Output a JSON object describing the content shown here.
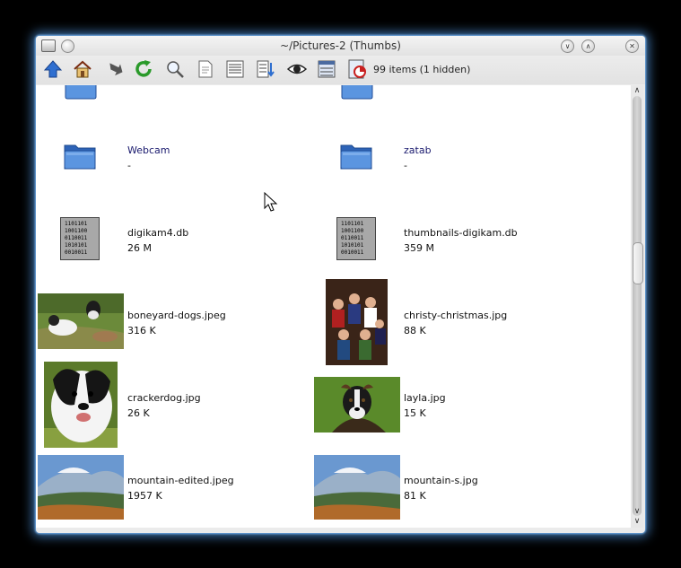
{
  "window": {
    "title": "~/Pictures-2 (Thumbs)"
  },
  "toolbar": {
    "status_text": "99 items (1 hidden)",
    "buttons": [
      {
        "name": "up-arrow-icon"
      },
      {
        "name": "home-icon"
      },
      {
        "name": "back-arrow-icon"
      },
      {
        "name": "reload-icon"
      },
      {
        "name": "zoom-icon"
      },
      {
        "name": "document-icon"
      },
      {
        "name": "list-view-icon"
      },
      {
        "name": "sort-icon"
      },
      {
        "name": "eye-icon"
      },
      {
        "name": "detail-view-icon"
      },
      {
        "name": "disk-usage-icon"
      }
    ]
  },
  "items": {
    "webcam": {
      "name": "Webcam",
      "size": "-"
    },
    "zatab": {
      "name": "zatab",
      "size": "-"
    },
    "digikam": {
      "name": "digikam4.db",
      "size": "26 M"
    },
    "thumbnails": {
      "name": "thumbnails-digikam.db",
      "size": "359 M"
    },
    "boneyard": {
      "name": "boneyard-dogs.jpeg",
      "size": "316 K"
    },
    "christy": {
      "name": "christy-christmas.jpg",
      "size": "88 K"
    },
    "cracker": {
      "name": "crackerdog.jpg",
      "size": "26 K"
    },
    "layla": {
      "name": "layla.jpg",
      "size": "15 K"
    },
    "mountain_edited": {
      "name": "mountain-edited.jpeg",
      "size": "1957 K"
    },
    "mountain_s": {
      "name": "mountain-s.jpg",
      "size": "81 K"
    }
  },
  "db_icon_text": [
    "1101101",
    "1001100",
    "0110011",
    "1010101",
    "0010011"
  ],
  "colors": {
    "glow": "#5aaaff",
    "folder": "#3a78c8",
    "link": "#1a1a6e"
  }
}
